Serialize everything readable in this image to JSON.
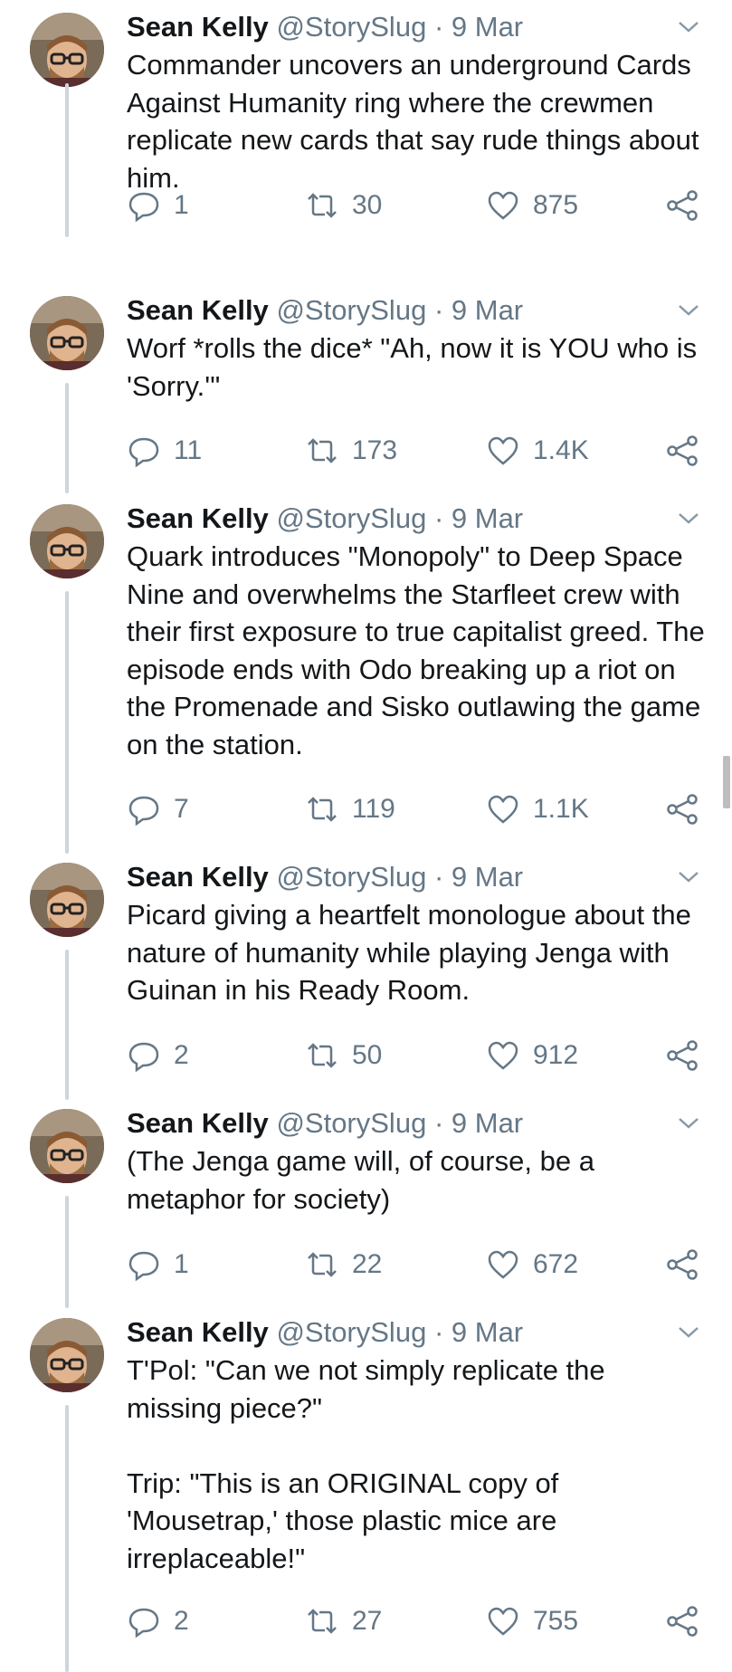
{
  "tweets": [
    {
      "name": "Sean Kelly",
      "handle": "@StorySlug",
      "date": "9 Mar",
      "text": "Commander uncovers an underground Cards Against Humanity ring where the crewmen replicate new cards that say rude things about him.",
      "replies": "1",
      "retweets": "30",
      "likes": "875"
    },
    {
      "name": "Sean Kelly",
      "handle": "@StorySlug",
      "date": "9 Mar",
      "text": "Worf *rolls the dice* \"Ah, now it is YOU who is 'Sorry.'\"",
      "replies": "11",
      "retweets": "173",
      "likes": "1.4K"
    },
    {
      "name": "Sean Kelly",
      "handle": "@StorySlug",
      "date": "9 Mar",
      "text": "Quark introduces \"Monopoly\" to Deep Space Nine and overwhelms the Starfleet crew with their first exposure to true capitalist greed. The episode ends with Odo breaking up a riot on the Promenade and Sisko outlawing the game on the station.",
      "replies": "7",
      "retweets": "119",
      "likes": "1.1K"
    },
    {
      "name": "Sean Kelly",
      "handle": "@StorySlug",
      "date": "9 Mar",
      "text": "Picard giving a heartfelt monologue about the nature of humanity while playing Jenga with Guinan in his Ready Room.",
      "replies": "2",
      "retweets": "50",
      "likes": "912"
    },
    {
      "name": "Sean Kelly",
      "handle": "@StorySlug",
      "date": "9 Mar",
      "text": "(The Jenga game will, of course, be a metaphor for society)",
      "replies": "1",
      "retweets": "22",
      "likes": "672"
    },
    {
      "name": "Sean Kelly",
      "handle": "@StorySlug",
      "date": "9 Mar",
      "text": "T'Pol: \"Can we not simply replicate the missing piece?\"\n\nTrip: \"This is an ORIGINAL copy of 'Mousetrap,' those plastic mice are irreplaceable!\"",
      "replies": "2",
      "retweets": "27",
      "likes": "755"
    }
  ],
  "icons": {
    "reply": "reply-icon",
    "retweet": "retweet-icon",
    "like": "heart-icon",
    "share": "share-icon",
    "more": "chevron-down-icon"
  },
  "colors": {
    "text": "#14171a",
    "secondary": "#657786",
    "thread_line": "#ccd6dd"
  },
  "separator": "·"
}
